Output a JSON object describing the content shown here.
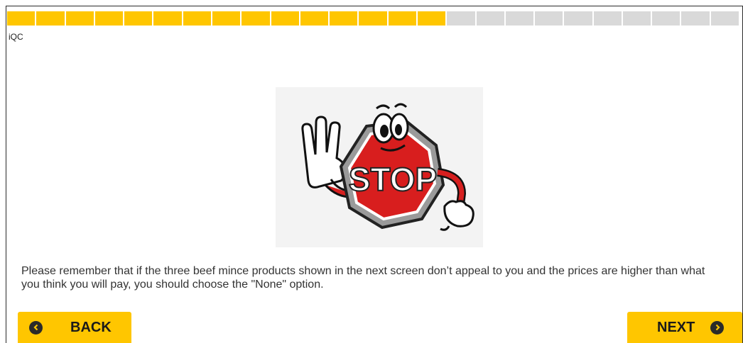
{
  "progress": {
    "total_segments": 25,
    "completed_segments": 15,
    "fill_color": "#ffc600",
    "empty_color": "#d9d9d9"
  },
  "brand": {
    "label": "iQC"
  },
  "image": {
    "sign_text": "STOP",
    "icon": "stop-sign-cartoon"
  },
  "message": {
    "text": "Please remember that if the three beef mince products shown in the next screen don’t appeal to you and the prices are higher than what you think you will pay, you should choose the \"None\" option."
  },
  "navigation": {
    "back_label": "BACK",
    "next_label": "NEXT",
    "accent_color": "#ffc600"
  }
}
